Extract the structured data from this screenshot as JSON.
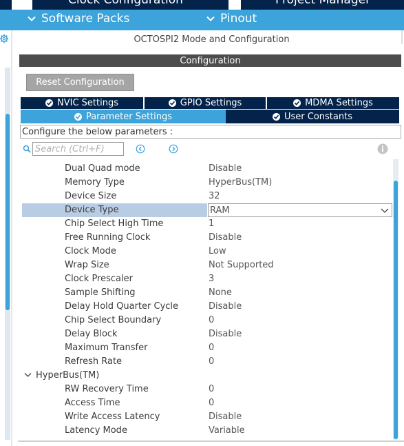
{
  "top_tabs": {
    "clock": "Clock Configuration",
    "project": "Project Manager"
  },
  "menu": {
    "software_packs": "Software Packs",
    "pinout": "Pinout"
  },
  "mode_title": "OCTOSPI2 Mode and Configuration",
  "config_header": "Configuration",
  "reset_button": "Reset Configuration",
  "tabs_row1": [
    "NVIC Settings",
    "GPIO Settings",
    "MDMA Settings"
  ],
  "tabs_row2": [
    "Parameter Settings",
    "User Constants"
  ],
  "hint": "Configure the below parameters :",
  "search": {
    "placeholder": "Search (Ctrl+F)"
  },
  "params": [
    {
      "name": "Dual Quad mode",
      "value": "Disable"
    },
    {
      "name": "Memory Type",
      "value": "HyperBus(TM)"
    },
    {
      "name": "Device Size",
      "value": "32"
    },
    {
      "name": "Device Type",
      "value": "RAM"
    },
    {
      "name": "Chip Select High Time",
      "value": "1"
    },
    {
      "name": "Free Running Clock",
      "value": "Disable"
    },
    {
      "name": "Clock Mode",
      "value": "Low"
    },
    {
      "name": "Wrap Size",
      "value": "Not Supported"
    },
    {
      "name": "Clock Prescaler",
      "value": "3"
    },
    {
      "name": "Sample Shifting",
      "value": "None"
    },
    {
      "name": "Delay Hold Quarter Cycle",
      "value": "Disable"
    },
    {
      "name": "Chip Select Boundary",
      "value": "0"
    },
    {
      "name": "Delay Block",
      "value": "Disable"
    },
    {
      "name": "Maximum Transfer",
      "value": "0"
    },
    {
      "name": "Refresh Rate",
      "value": "0"
    }
  ],
  "group": {
    "label": "HyperBus(TM)",
    "params": [
      {
        "name": "RW Recovery Time",
        "value": "0"
      },
      {
        "name": "Access Time",
        "value": "0"
      },
      {
        "name": "Write Access Latency",
        "value": "Disable"
      },
      {
        "name": "Latency Mode",
        "value": "Variable"
      }
    ]
  },
  "colors": {
    "navy": "#03234b",
    "accent_blue": "#3ca3db",
    "selection": "#b8cce4",
    "header_gray": "#4d4d4d",
    "button_gray": "#a5a5a5"
  }
}
